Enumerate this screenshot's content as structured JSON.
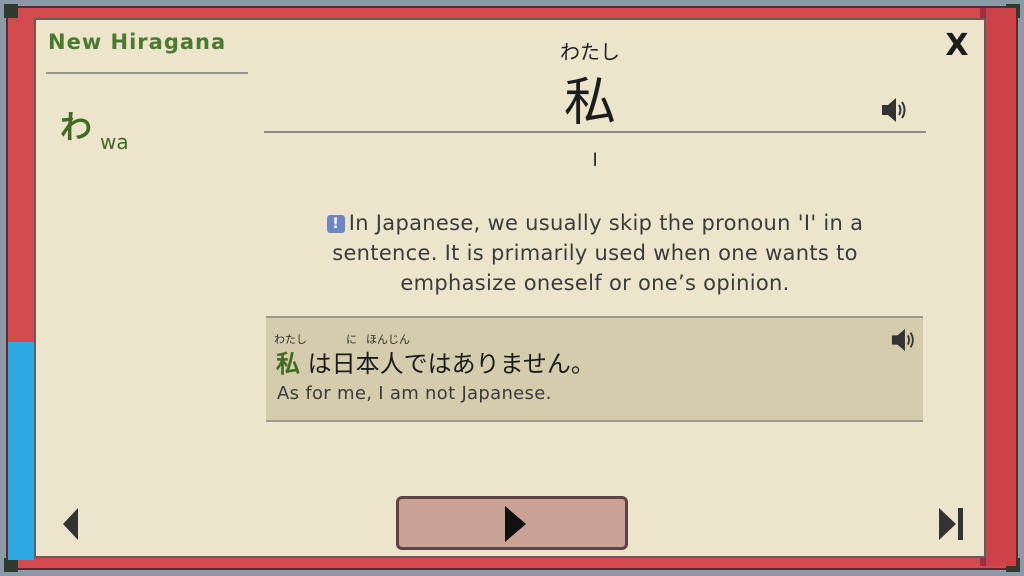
{
  "sidebar": {
    "title": "New Hiragana",
    "kana": "わ",
    "romaji": "wa"
  },
  "word": {
    "furigana": "わたし",
    "kanji": "私",
    "meaning": "I"
  },
  "note": {
    "icon": "exclamation-icon",
    "text": "In Japanese, we usually skip the pronoun 'I' in a sentence. It is primarily used when one wants to emphasize oneself or one’s opinion."
  },
  "example": {
    "furigana_1": "わたし",
    "furigana_2": "に",
    "furigana_3": "ほんじん",
    "highlight": "私",
    "rest": "は日本人ではありません。",
    "translation": "As for me, I am not Japanese."
  },
  "controls": {
    "close_label": "X",
    "icons": [
      "speaker-icon",
      "previous-arrow-icon",
      "play-icon",
      "skip-to-end-icon"
    ]
  },
  "colors": {
    "panel_background": "#ece5cc",
    "frame_red": "#d24a4e",
    "accent_green": "#3f6b22",
    "progress_blue": "#2ea8e0",
    "play_button": "#c9a195"
  }
}
